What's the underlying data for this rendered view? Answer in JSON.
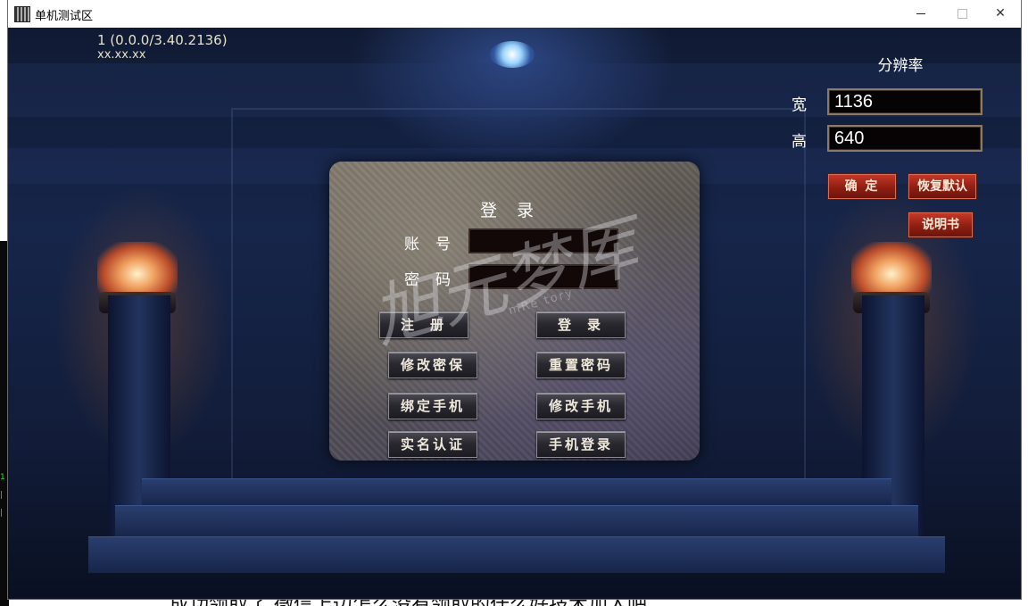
{
  "window": {
    "title": "单机测试区"
  },
  "game": {
    "version": "1 (0.0.0/3.40.2136)",
    "ip": "xx.xx.xx"
  },
  "resolution": {
    "title": "分辨率",
    "width_label": "宽",
    "width_value": "1136",
    "height_label": "高",
    "height_value": "640",
    "confirm_label": "确 定",
    "restore_label": "恢复默认",
    "manual_label": "说明书"
  },
  "login": {
    "title": "登录",
    "account_label": "账号",
    "account_value": "",
    "password_label": "密码",
    "password_value": "",
    "buttons": {
      "register": "注册",
      "login": "登录",
      "change_security": "修改密保",
      "reset_password": "重置密码",
      "bind_phone": "绑定手机",
      "change_phone": "修改手机",
      "real_name": "实名认证",
      "phone_login": "手机登录"
    }
  },
  "watermark": {
    "text": "旭元梦厍",
    "sub": "mRe tory"
  },
  "background_text": {
    "bottom": "成功领取了  微信上边怎么没有领取的什么好技术加入吧"
  }
}
